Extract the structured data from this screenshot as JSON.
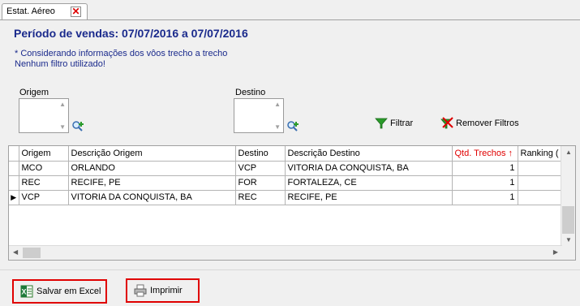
{
  "tab": {
    "label": "Estat. Aéreo"
  },
  "header": {
    "period": "Período de vendas: 07/07/2016 a 07/07/2016",
    "note1": "* Considerando informações dos vôos trecho a trecho",
    "note2": "Nenhum filtro utilizado!"
  },
  "filters": {
    "origem_label": "Origem",
    "destino_label": "Destino",
    "filtrar_label": "Filtrar",
    "remover_label": "Remover Filtros"
  },
  "grid": {
    "columns": [
      "Origem",
      "Descrição Origem",
      "Destino",
      "Descrição Destino",
      "Qtd. Trechos ↑",
      "Ranking ("
    ],
    "rows": [
      [
        "MCO",
        "ORLANDO",
        "VCP",
        "VITORIA DA CONQUISTA, BA",
        "1",
        ""
      ],
      [
        "REC",
        "RECIFE, PE",
        "FOR",
        "FORTALEZA, CE",
        "1",
        ""
      ],
      [
        "VCP",
        "VITORIA DA CONQUISTA, BA",
        "REC",
        "RECIFE, PE",
        "1",
        ""
      ]
    ],
    "current_row_marker": "▶"
  },
  "actions": {
    "excel_label": "Salvar em Excel",
    "print_label": "Imprimir"
  },
  "colors": {
    "title_blue": "#1a2a8c",
    "highlight_red": "#e00000"
  }
}
